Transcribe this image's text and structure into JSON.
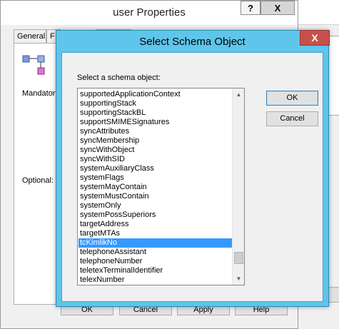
{
  "background_dialog": {
    "title": "user Properties",
    "help_button": "?",
    "close_button": "X",
    "tabs": [
      "General",
      "F",
      ""
    ],
    "mandatory_label": "Mandatory",
    "optional_label": "Optional:",
    "buttons": {
      "ok": "OK",
      "cancel": "Cancel",
      "apply": "Apply",
      "help": "Help"
    }
  },
  "dialog": {
    "title": "Select Schema Object",
    "close_button": "X",
    "prompt": "Select a schema object:",
    "ok_button": "OK",
    "cancel_button": "Cancel",
    "selected_item": "tcKimlikNo",
    "items": [
      "supportedApplicationContext",
      "supportingStack",
      "supportingStackBL",
      "supportSMIMESignatures",
      "syncAttributes",
      "syncMembership",
      "syncWithObject",
      "syncWithSID",
      "systemAuxiliaryClass",
      "systemFlags",
      "systemMayContain",
      "systemMustContain",
      "systemOnly",
      "systemPossSuperiors",
      "targetAddress",
      "targetMTAs",
      "tcKimlikNo",
      "telephoneAssistant",
      "telephoneNumber",
      "teletexTerminalIdentifier",
      "telexNumber"
    ]
  },
  "colors": {
    "dialog_frame": "#5fc5ea",
    "selection": "#3399ff",
    "close_red": "#c7504b"
  },
  "icons": [
    "tree-icon",
    "scroll-up-icon",
    "scroll-down-icon"
  ]
}
